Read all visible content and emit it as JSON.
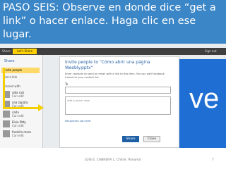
{
  "slide": {
    "title": "PASO SEIS: Observe en donde dice “get a  link” o hacer enlace. Haga clic en ese lugar."
  },
  "screenshot": {
    "topbar": {
      "share_tab": "Let's Share",
      "left_text": "Share",
      "right_text": "Sign out"
    },
    "left_panel": {
      "header": "Share",
      "invite": "Invite people",
      "get_link": "Get a link",
      "shared_with": "Shared with",
      "people": [
        {
          "name": "aida ruiz",
          "perm": "Can edit"
        },
        {
          "name": "ana zapata",
          "perm": "Can edit"
        },
        {
          "name": "carla",
          "perm": "Can edit"
        },
        {
          "name": "Elvia Pitty",
          "perm": "Can edit"
        },
        {
          "name": "franklin mera",
          "perm": "Can edit"
        }
      ]
    },
    "dialog": {
      "title": "Invite people to “Cómo abrir una página Weebly.pptx”",
      "description": "Enter contacts to send an email with a link to this item. You can add Facebook friends to your contact list.",
      "to_label": "To",
      "note_placeholder": "Add a quick note",
      "recipients_link": "Recipients can edit",
      "share_button": "Share",
      "close_button": "Close"
    },
    "background_word": "ve"
  },
  "footer": {
    "text": "LUIS E. CABRERA L.  Chitré, Panamá",
    "page": "7"
  },
  "colors": {
    "banner": "#3b86c7",
    "highlight": "#f5d000",
    "brand_blue": "#1f6ed4"
  }
}
